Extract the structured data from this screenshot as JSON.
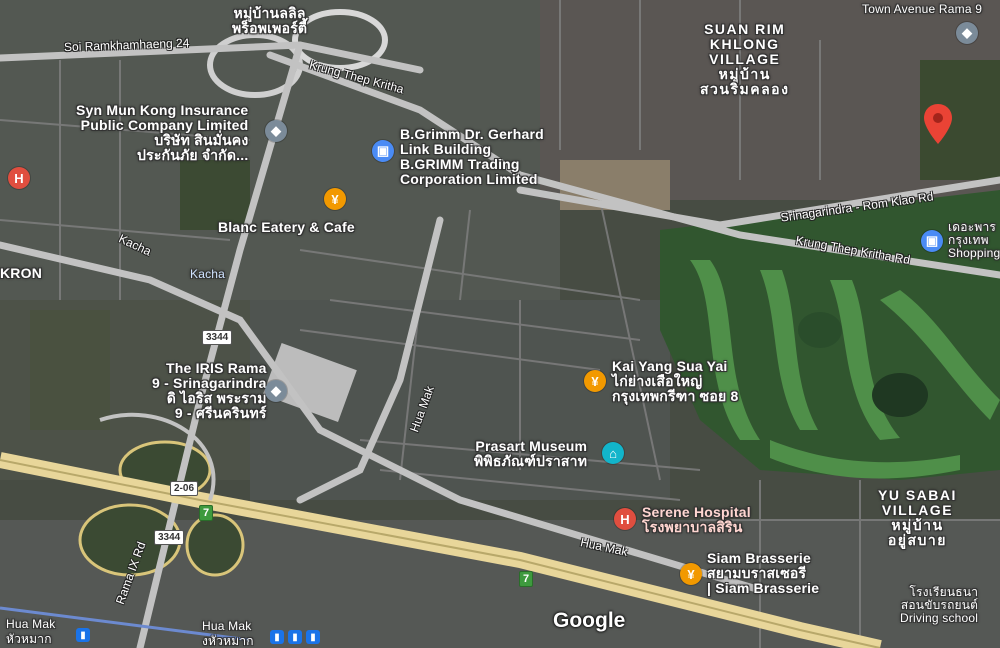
{
  "map": {
    "places": {
      "syn_mun_kong": {
        "name1": "Syn Mun Kong Insurance",
        "name2": "Public Company Limited",
        "thai1": "บริษัท สินมั่นคง",
        "thai2": "ประกันภัย จำกัด..."
      },
      "bgrimm_link": {
        "name1": "B.Grimm Dr. Gerhard",
        "name2": "Link Building",
        "sub1": "B.GRIMM Trading",
        "sub2": "Corporation Limited"
      },
      "blanc_eatery": {
        "name": "Blanc Eatery & Cafe"
      },
      "iris": {
        "name1": "The IRIS Rama",
        "name2": "9 - Srinagarindra",
        "thai1": "ดิ ไอริส พระราม",
        "thai2": "9 - ศรีนครินทร์"
      },
      "kai_yang": {
        "name": "Kai Yang Sua Yai",
        "thai1": "ไก่ย่างเสือใหญ่",
        "thai2": "กรุงเทพกรีฑา ซอย 8"
      },
      "prasart": {
        "name": "Prasart Museum",
        "thai": "พิพิธภัณฑ์ปราสาท"
      },
      "serene": {
        "name": "Serene Hospital",
        "thai": "โรงพยาบาลสิริน"
      },
      "siam_brasserie": {
        "name": "Siam Brasserie",
        "thai": "สยามบราสเซอรี",
        "sub": "| Siam Brasserie"
      },
      "town_avenue": {
        "name": "Town Avenue Rama 9"
      },
      "shopping": {
        "thai1": "เดอะพาร",
        "thai2": "กรุงเทพ",
        "sub": "Shopping"
      },
      "driving_school": {
        "thai1": "โรงเรียนธนา",
        "thai2": "สอนขับรถยนต์",
        "sub": "Driving school"
      },
      "village_top": {
        "thai1": "หมู่บ้านลลิล",
        "thai2": "พร็อพเพอร์ตี้"
      },
      "suan_rim": {
        "line1": "SUAN RIM",
        "line2": "KHLONG",
        "line3": "VILLAGE",
        "thai1": "หมู่บ้าน",
        "thai2": "สวนริมคลอง"
      },
      "yu_sabai": {
        "line1": "YU SABAI",
        "line2": "VILLAGE",
        "thai1": "หมู่บ้าน",
        "thai2": "อยู่สบาย"
      },
      "hua_mak_left": {
        "name": "Hua Mak",
        "thai": "หัวหมาก"
      },
      "hua_mak_station": {
        "name": "Hua Mak",
        "thai": "งหัวหมาก"
      },
      "kron": {
        "name": "KRON"
      },
      "kacha_area": {
        "name": "Kacha"
      }
    },
    "roads": {
      "soi_ramkhamhaeng": "Soi Ramkhamhaeng 24",
      "krung_thep_kritha_top": "Krung Thep Kritha",
      "srinagarindra": "Srinagarindra - Rom Klao Rd",
      "krung_thep_kritha_rd": "Krung Thep Kritha Rd",
      "kacha": "Kacha",
      "hua_mak_vertical": "Hua Mak",
      "hua_mak_lower": "Hua Mak",
      "rama9": "Rama IX Rd"
    },
    "shields": {
      "s3344_a": "3344",
      "s3344_b": "3344",
      "s206": "2-06",
      "green_a": "7",
      "green_b": "7"
    },
    "icons": {
      "grey_pin": "building-icon",
      "orange_pin": "restaurant-icon",
      "red_pin": "hospital-icon",
      "teal_pin": "museum-icon",
      "blue_pin": "shopping-icon",
      "selected_marker": "map-marker-icon",
      "transit": "train-icon"
    },
    "branding": "Google",
    "colors": {
      "restaurant": "#f29900",
      "hospital": "#e04e3f",
      "museum": "#12b5cb",
      "building": "#7b8b99",
      "shopping": "#4a8bf5",
      "selected_marker": "#ea4335"
    }
  }
}
